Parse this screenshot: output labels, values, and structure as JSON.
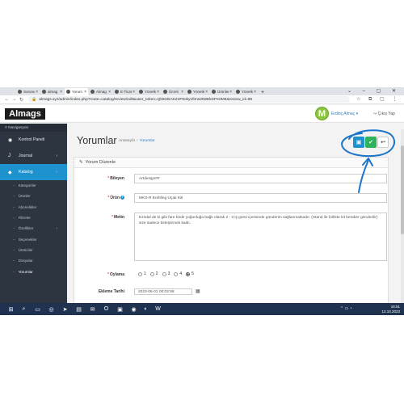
{
  "browser": {
    "tabs": [
      {
        "label": "Sorunu"
      },
      {
        "label": "almag"
      },
      {
        "label": "Yorum",
        "active": true
      },
      {
        "label": "Almag"
      },
      {
        "label": "E-Ticar"
      },
      {
        "label": "Yönetk"
      },
      {
        "label": "Ücreti"
      },
      {
        "label": "Yönetk"
      },
      {
        "label": "Ürünler"
      },
      {
        "label": "Yönetk"
      }
    ],
    "url": "almags.xyz/admin/index.php?route=catalog/review/edit&user_token=Qk5GBAKZ4F9oky1f0ns3N8EkDFK0M5&review_id=98"
  },
  "app": {
    "logo": "Almags",
    "user_initial": "M",
    "user_name": "Erdinç Almaç",
    "logout": "Çıkış Yap"
  },
  "sidebar": {
    "nav_title": "Navigasyon",
    "items": [
      {
        "label": "Kontrol Paneli",
        "icon": "dashboard-icon"
      },
      {
        "label": "Journal",
        "icon": "journal-icon"
      },
      {
        "label": "Katalog",
        "icon": "tag-icon",
        "active": true
      }
    ],
    "subitems": [
      {
        "label": "Kategoriler"
      },
      {
        "label": "Ürünler"
      },
      {
        "label": "Abonelikler"
      },
      {
        "label": "Filtreler"
      },
      {
        "label": "Özellikler"
      },
      {
        "label": "Seçenekler"
      },
      {
        "label": "Üreticiler"
      },
      {
        "label": "Dosyalar"
      },
      {
        "label": "Yorumlar",
        "current": true
      }
    ]
  },
  "page": {
    "title": "Yorumlar",
    "breadcrumb_home": "Anasayfa",
    "breadcrumb_current": "Yorumlar"
  },
  "form": {
    "panel_title": "Yorum Düzenle",
    "author_label": "Bileyen",
    "author_value": "Artdesign##",
    "product_label": "Ürün",
    "product_value": "MKS-R Ereltling Uçak Kiti",
    "text_label": "Metin",
    "text_value": "Ezirdal de ki gibi fare birdir yoğunluğa bağlı olarak 2 - 3 iş günü içerisinde gönderim sağlanmaktadır. (Stand ile birlikte kit beraber gönderilir) size sadece birleştirmek kaldı.",
    "rating_label": "Oylama",
    "rating_options": [
      "1",
      "2",
      "3",
      "4",
      "5"
    ],
    "rating_selected": "5",
    "date_label": "Ekleme Tarihi",
    "date_value": "2023-06-01 00:02:58"
  },
  "taskbar": {
    "time": "16:51",
    "date": "12.10.2023"
  },
  "colors": {
    "sidebar_bg": "#2d3540",
    "accent_blue": "#1e91cf",
    "save_green": "#2fb35a",
    "annotation_blue": "#1b76c9"
  }
}
